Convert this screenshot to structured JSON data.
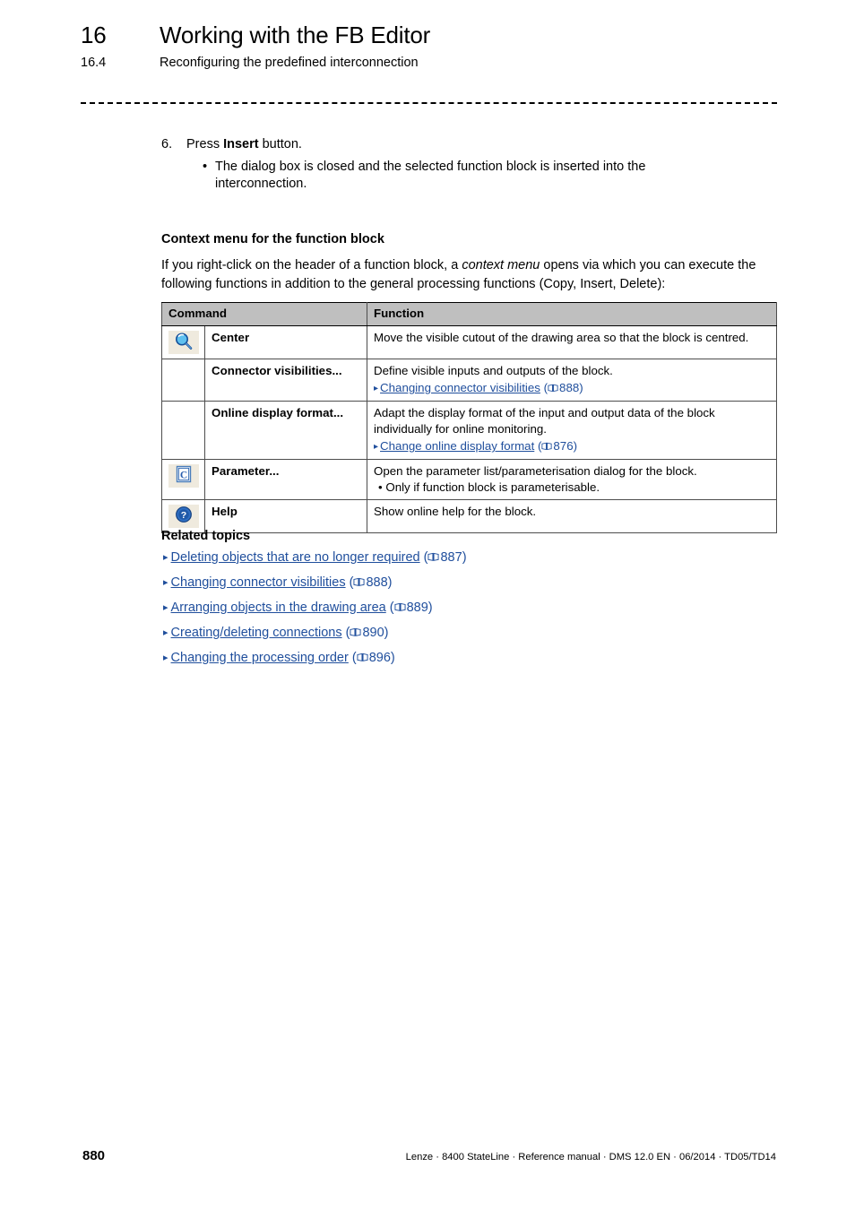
{
  "header": {
    "chapter_number": "16",
    "chapter_title": "Working with the FB Editor",
    "section_number": "16.4",
    "section_title": "Reconfiguring the predefined interconnection"
  },
  "steps": {
    "number": "6.",
    "text_before": "Press ",
    "bold": "Insert",
    "text_after": " button.",
    "bullet_dot": "•",
    "bullet_text": "The dialog box is closed and the selected function block is inserted into the interconnection."
  },
  "context_section": {
    "heading": "Context menu for the function block",
    "intro_part1": "If you right-click on the header of a function block, a ",
    "intro_italic": "context menu",
    "intro_part2": " opens via which you can execute the following functions in addition to the general processing functions (Copy, Insert, Delete):"
  },
  "table": {
    "headers": {
      "command": "Command",
      "function": "Function"
    },
    "rows": [
      {
        "icon": "magnifier-icon",
        "command": "Center",
        "function_text": "Move the visible cutout of the drawing area so that the block is centred.",
        "xref": null,
        "sub_bullet": null
      },
      {
        "icon": null,
        "command": "Connector visibilities...",
        "function_text": "Define visible inputs and outputs of the block.",
        "xref": {
          "arrow": "▸",
          "label": "Changing connector visibilities",
          "page": "888"
        },
        "sub_bullet": null
      },
      {
        "icon": null,
        "command": "Online display format...",
        "function_text": "Adapt the display format of the input and output data of the block individually for online monitoring.",
        "xref": {
          "arrow": "▸",
          "label": "Change online display format",
          "page": "876"
        },
        "sub_bullet": null
      },
      {
        "icon": "parameter-c-icon",
        "command": "Parameter...",
        "function_text": "Open the parameter list/parameterisation dialog for the block.",
        "xref": null,
        "sub_bullet": "• Only if function block is parameterisable."
      },
      {
        "icon": "help-question-icon",
        "command": "Help",
        "function_text": "Show online help for the block.",
        "xref": null,
        "sub_bullet": null
      }
    ]
  },
  "related": {
    "heading": "Related topics",
    "items": [
      {
        "arrow": "▸",
        "label": "Deleting objects that are no longer required",
        "page": "887"
      },
      {
        "arrow": "▸",
        "label": "Changing connector visibilities",
        "page": "888"
      },
      {
        "arrow": "▸",
        "label": "Arranging objects in the drawing area",
        "page": "889"
      },
      {
        "arrow": "▸",
        "label": "Creating/deleting connections",
        "page": "890"
      },
      {
        "arrow": "▸",
        "label": "Changing the processing order",
        "page": "896"
      }
    ]
  },
  "footer": {
    "page_number": "880",
    "meta": "Lenze · 8400 StateLine · Reference manual · DMS 12.0 EN · 06/2014 · TD05/TD14"
  },
  "colors": {
    "link": "#1f4e9c",
    "table_header_bg": "#bfbfbf",
    "icon_chip_bg": "#efeade",
    "text": "#000000"
  }
}
